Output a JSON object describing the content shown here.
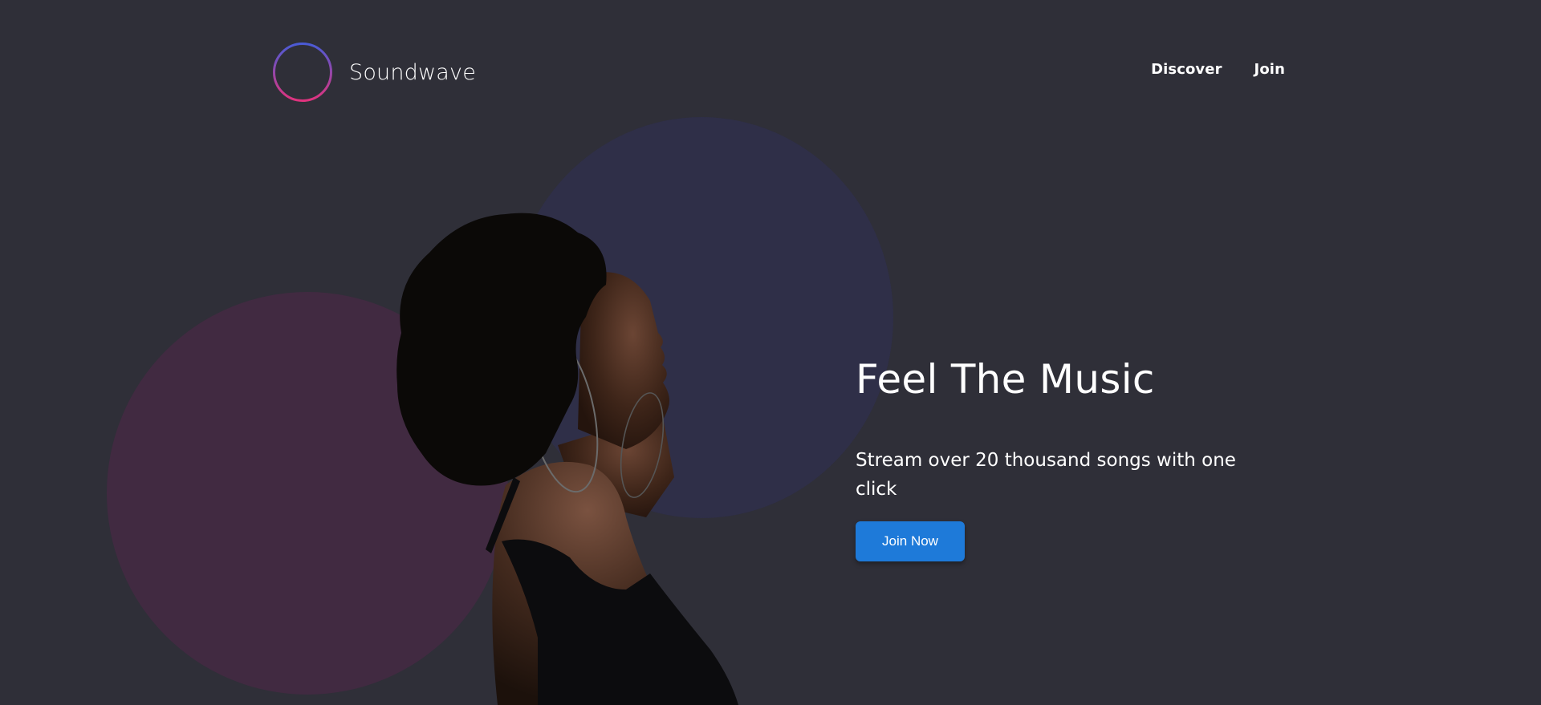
{
  "brand": {
    "name": "Soundwave",
    "logo_icon": "soundwave-logo-icon"
  },
  "nav": {
    "items": [
      {
        "label": "Discover"
      },
      {
        "label": "Join"
      }
    ]
  },
  "hero": {
    "title": "Feel The Music",
    "subtitle": "Stream over 20 thousand songs with one click",
    "cta_label": "Join Now",
    "image": "woman-listening-to-music-photo"
  },
  "colors": {
    "background": "#2f2f38",
    "circle_purple": "#2f2f48",
    "circle_pink": "#412a41",
    "button": "#1e7ad9",
    "logo_gradient_start": "#4a5bd6",
    "logo_gradient_end": "#e0337e"
  }
}
